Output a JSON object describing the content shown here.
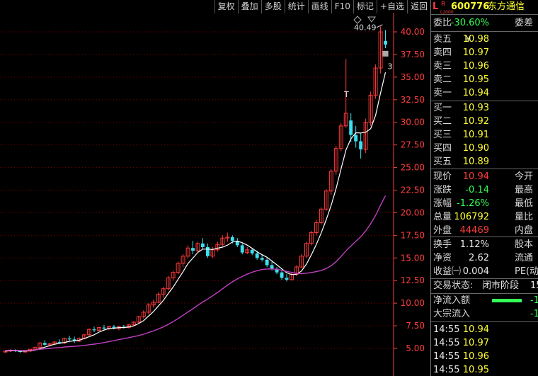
{
  "toolbar": [
    "复权",
    "叠加",
    "多股",
    "统计",
    "画线",
    "F10",
    "标记",
    "+自选",
    "返回"
  ],
  "stock": {
    "badge_l": "L",
    "badge_r": "R",
    "badge_level": "L2000",
    "code": "600776",
    "name": "东方通信"
  },
  "weibi": {
    "label": "委比",
    "value": "-30.60%",
    "label2": "委差"
  },
  "sells": [
    {
      "label": "卖五",
      "mark": "￥",
      "price": "10.98"
    },
    {
      "label": "卖四",
      "price": "10.97"
    },
    {
      "label": "卖三",
      "price": "10.96"
    },
    {
      "label": "卖二",
      "price": "10.95"
    },
    {
      "label": "卖一",
      "price": "10.94"
    }
  ],
  "buys": [
    {
      "label": "买一",
      "price": "10.93"
    },
    {
      "label": "买二",
      "price": "10.92"
    },
    {
      "label": "买三",
      "price": "10.91"
    },
    {
      "label": "买四",
      "price": "10.90"
    },
    {
      "label": "买五",
      "price": "10.89"
    }
  ],
  "quote": [
    {
      "label": "现价",
      "value": "10.94",
      "label2": "今开",
      "cls": "red"
    },
    {
      "label": "涨跌",
      "value": "-0.14",
      "label2": "最高",
      "cls": "green"
    },
    {
      "label": "涨幅",
      "value": "-1.26%",
      "label2": "最低",
      "cls": "green"
    },
    {
      "label": "总量",
      "value": "106792",
      "label2": "量比",
      "cls": "yellow"
    },
    {
      "label": "外盘",
      "value": "44469",
      "label2": "内盘",
      "cls": "red"
    }
  ],
  "fundamentals": [
    {
      "label": "换手",
      "value": "1.12%",
      "label2": "股本"
    },
    {
      "label": "净资",
      "value": "2.62",
      "label2": "流通"
    },
    {
      "label": "收益㈠",
      "value": "0.004",
      "label2": "PE(动"
    }
  ],
  "status": {
    "label": "交易状态:",
    "value": "闭市阶段",
    "suffix": "15"
  },
  "flows": [
    {
      "label": "净流入额",
      "value": "-1",
      "bar": 0.75
    },
    {
      "label": "大宗流入",
      "value": "-1",
      "bar": 0
    }
  ],
  "ticks": [
    {
      "time": "14:55",
      "price": "10.94"
    },
    {
      "time": "14:55",
      "price": "10.97"
    },
    {
      "time": "14:55",
      "price": "10.96"
    },
    {
      "time": "14:55",
      "price": "10.95"
    },
    {
      "time": "14:55",
      "price": "10.94"
    }
  ],
  "chart_data": {
    "type": "candlestick",
    "y_ticks": [
      "40.00",
      "37.50",
      "35.00",
      "32.50",
      "30.00",
      "27.50",
      "25.00",
      "22.50",
      "20.00",
      "17.50",
      "15.00",
      "12.50",
      "10.00",
      "7.50",
      "5.00"
    ],
    "ylim": [
      3.5,
      42.0
    ],
    "price_label": "40.49",
    "marker_t": "T",
    "marker_3": "3",
    "grid": "horizontal-dotted",
    "colors": {
      "up": "#ff3c3c",
      "down": "#3ce0f0",
      "ma_short": "#ffffff",
      "ma_long": "#c040c0",
      "axis": "#ff3c3c"
    },
    "candles": [
      [
        4.6,
        4.8,
        4.5,
        4.7
      ],
      [
        4.7,
        4.9,
        4.6,
        4.8
      ],
      [
        4.8,
        4.9,
        4.6,
        4.7
      ],
      [
        4.7,
        4.8,
        4.5,
        4.6
      ],
      [
        4.6,
        4.8,
        4.5,
        4.7
      ],
      [
        4.7,
        4.9,
        4.6,
        4.9
      ],
      [
        4.9,
        5.2,
        4.8,
        5.1
      ],
      [
        5.1,
        5.7,
        5.0,
        5.6
      ],
      [
        5.6,
        5.9,
        5.3,
        5.4
      ],
      [
        5.4,
        5.6,
        5.2,
        5.5
      ],
      [
        5.5,
        5.8,
        5.4,
        5.7
      ],
      [
        5.7,
        6.0,
        5.5,
        5.6
      ],
      [
        5.6,
        6.2,
        5.5,
        6.1
      ],
      [
        6.1,
        6.4,
        5.8,
        6.0
      ],
      [
        6.0,
        6.3,
        5.6,
        5.8
      ],
      [
        5.8,
        6.2,
        5.7,
        6.1
      ],
      [
        6.1,
        6.6,
        6.0,
        6.5
      ],
      [
        6.5,
        7.2,
        6.4,
        7.1
      ],
      [
        7.1,
        7.4,
        6.8,
        7.0
      ],
      [
        7.0,
        7.4,
        6.9,
        7.3
      ],
      [
        7.3,
        7.6,
        7.0,
        7.2
      ],
      [
        7.2,
        7.5,
        7.0,
        7.4
      ],
      [
        7.4,
        7.6,
        7.1,
        7.2
      ],
      [
        7.2,
        7.5,
        7.0,
        7.4
      ],
      [
        7.4,
        7.6,
        7.2,
        7.3
      ],
      [
        7.3,
        7.7,
        7.2,
        7.6
      ],
      [
        7.6,
        8.0,
        7.5,
        7.9
      ],
      [
        7.9,
        8.6,
        7.8,
        8.5
      ],
      [
        8.5,
        9.2,
        8.3,
        9.0
      ],
      [
        9.0,
        10.0,
        8.8,
        9.8
      ],
      [
        9.8,
        10.4,
        9.5,
        10.1
      ],
      [
        10.1,
        11.2,
        10.0,
        11.0
      ],
      [
        11.0,
        11.8,
        10.6,
        11.6
      ],
      [
        11.6,
        13.0,
        11.4,
        12.8
      ],
      [
        12.8,
        13.6,
        12.5,
        13.4
      ],
      [
        13.4,
        14.6,
        13.2,
        14.4
      ],
      [
        14.4,
        15.4,
        14.0,
        15.2
      ],
      [
        15.2,
        16.4,
        15.0,
        16.1
      ],
      [
        16.1,
        16.9,
        15.4,
        15.8
      ],
      [
        15.8,
        16.8,
        15.6,
        16.6
      ],
      [
        16.6,
        17.2,
        16.0,
        16.2
      ],
      [
        16.2,
        16.6,
        15.0,
        15.2
      ],
      [
        15.2,
        16.2,
        15.0,
        15.9
      ],
      [
        15.9,
        16.8,
        15.7,
        16.5
      ],
      [
        16.5,
        17.5,
        16.3,
        17.2
      ],
      [
        17.2,
        17.8,
        16.8,
        17.3
      ],
      [
        17.3,
        17.5,
        16.6,
        16.9
      ],
      [
        16.9,
        17.2,
        16.2,
        16.4
      ],
      [
        16.4,
        16.6,
        15.4,
        15.6
      ],
      [
        15.6,
        16.2,
        15.4,
        15.9
      ],
      [
        15.9,
        16.1,
        15.3,
        15.5
      ],
      [
        15.5,
        15.8,
        14.8,
        15.0
      ],
      [
        15.0,
        15.4,
        14.6,
        14.8
      ],
      [
        14.8,
        15.0,
        14.0,
        14.2
      ],
      [
        14.2,
        14.6,
        13.6,
        13.8
      ],
      [
        13.8,
        14.0,
        13.2,
        13.4
      ],
      [
        13.4,
        13.6,
        12.6,
        12.8
      ],
      [
        12.8,
        13.2,
        12.4,
        12.6
      ],
      [
        12.6,
        13.4,
        12.5,
        13.2
      ],
      [
        13.2,
        14.2,
        13.0,
        14.0
      ],
      [
        14.0,
        15.4,
        13.9,
        15.2
      ],
      [
        15.2,
        16.8,
        15.0,
        16.6
      ],
      [
        16.6,
        18.0,
        16.4,
        17.8
      ],
      [
        17.8,
        19.2,
        17.5,
        18.9
      ],
      [
        18.9,
        20.6,
        18.7,
        20.4
      ],
      [
        20.4,
        22.6,
        20.2,
        22.4
      ],
      [
        22.4,
        24.8,
        22.0,
        24.6
      ],
      [
        24.6,
        27.4,
        24.2,
        27.1
      ],
      [
        27.1,
        29.9,
        26.8,
        29.6
      ],
      [
        29.6,
        37.0,
        29.4,
        31.0
      ],
      [
        30.2,
        31.0,
        27.8,
        28.6
      ],
      [
        28.6,
        29.6,
        27.2,
        27.9
      ],
      [
        27.9,
        28.8,
        26.0,
        27.0
      ],
      [
        27.0,
        30.4,
        26.6,
        30.0
      ],
      [
        30.0,
        33.4,
        29.6,
        33.0
      ],
      [
        33.0,
        36.4,
        32.6,
        36.0
      ],
      [
        36.0,
        40.6,
        35.4,
        40.0
      ],
      [
        39.0,
        40.2,
        38.2,
        38.6
      ]
    ]
  }
}
